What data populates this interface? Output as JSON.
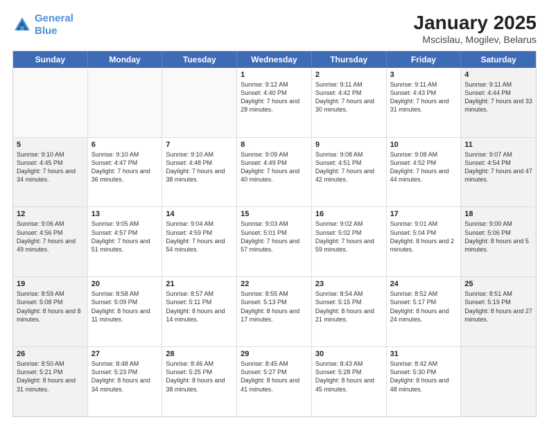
{
  "logo": {
    "line1": "General",
    "line2": "Blue"
  },
  "title": "January 2025",
  "subtitle": "Mscislau, Mogilev, Belarus",
  "days": [
    "Sunday",
    "Monday",
    "Tuesday",
    "Wednesday",
    "Thursday",
    "Friday",
    "Saturday"
  ],
  "rows": [
    [
      {
        "num": "",
        "sunrise": "",
        "sunset": "",
        "daylight": "",
        "shaded": false,
        "empty": true
      },
      {
        "num": "",
        "sunrise": "",
        "sunset": "",
        "daylight": "",
        "shaded": false,
        "empty": true
      },
      {
        "num": "",
        "sunrise": "",
        "sunset": "",
        "daylight": "",
        "shaded": false,
        "empty": true
      },
      {
        "num": "1",
        "sunrise": "Sunrise: 9:12 AM",
        "sunset": "Sunset: 4:40 PM",
        "daylight": "Daylight: 7 hours and 28 minutes.",
        "shaded": false,
        "empty": false
      },
      {
        "num": "2",
        "sunrise": "Sunrise: 9:11 AM",
        "sunset": "Sunset: 4:42 PM",
        "daylight": "Daylight: 7 hours and 30 minutes.",
        "shaded": false,
        "empty": false
      },
      {
        "num": "3",
        "sunrise": "Sunrise: 9:11 AM",
        "sunset": "Sunset: 4:43 PM",
        "daylight": "Daylight: 7 hours and 31 minutes.",
        "shaded": false,
        "empty": false
      },
      {
        "num": "4",
        "sunrise": "Sunrise: 9:11 AM",
        "sunset": "Sunset: 4:44 PM",
        "daylight": "Daylight: 7 hours and 33 minutes.",
        "shaded": true,
        "empty": false
      }
    ],
    [
      {
        "num": "5",
        "sunrise": "Sunrise: 9:10 AM",
        "sunset": "Sunset: 4:45 PM",
        "daylight": "Daylight: 7 hours and 34 minutes.",
        "shaded": true,
        "empty": false
      },
      {
        "num": "6",
        "sunrise": "Sunrise: 9:10 AM",
        "sunset": "Sunset: 4:47 PM",
        "daylight": "Daylight: 7 hours and 36 minutes.",
        "shaded": false,
        "empty": false
      },
      {
        "num": "7",
        "sunrise": "Sunrise: 9:10 AM",
        "sunset": "Sunset: 4:48 PM",
        "daylight": "Daylight: 7 hours and 38 minutes.",
        "shaded": false,
        "empty": false
      },
      {
        "num": "8",
        "sunrise": "Sunrise: 9:09 AM",
        "sunset": "Sunset: 4:49 PM",
        "daylight": "Daylight: 7 hours and 40 minutes.",
        "shaded": false,
        "empty": false
      },
      {
        "num": "9",
        "sunrise": "Sunrise: 9:08 AM",
        "sunset": "Sunset: 4:51 PM",
        "daylight": "Daylight: 7 hours and 42 minutes.",
        "shaded": false,
        "empty": false
      },
      {
        "num": "10",
        "sunrise": "Sunrise: 9:08 AM",
        "sunset": "Sunset: 4:52 PM",
        "daylight": "Daylight: 7 hours and 44 minutes.",
        "shaded": false,
        "empty": false
      },
      {
        "num": "11",
        "sunrise": "Sunrise: 9:07 AM",
        "sunset": "Sunset: 4:54 PM",
        "daylight": "Daylight: 7 hours and 47 minutes.",
        "shaded": true,
        "empty": false
      }
    ],
    [
      {
        "num": "12",
        "sunrise": "Sunrise: 9:06 AM",
        "sunset": "Sunset: 4:56 PM",
        "daylight": "Daylight: 7 hours and 49 minutes.",
        "shaded": true,
        "empty": false
      },
      {
        "num": "13",
        "sunrise": "Sunrise: 9:05 AM",
        "sunset": "Sunset: 4:57 PM",
        "daylight": "Daylight: 7 hours and 51 minutes.",
        "shaded": false,
        "empty": false
      },
      {
        "num": "14",
        "sunrise": "Sunrise: 9:04 AM",
        "sunset": "Sunset: 4:59 PM",
        "daylight": "Daylight: 7 hours and 54 minutes.",
        "shaded": false,
        "empty": false
      },
      {
        "num": "15",
        "sunrise": "Sunrise: 9:03 AM",
        "sunset": "Sunset: 5:01 PM",
        "daylight": "Daylight: 7 hours and 57 minutes.",
        "shaded": false,
        "empty": false
      },
      {
        "num": "16",
        "sunrise": "Sunrise: 9:02 AM",
        "sunset": "Sunset: 5:02 PM",
        "daylight": "Daylight: 7 hours and 59 minutes.",
        "shaded": false,
        "empty": false
      },
      {
        "num": "17",
        "sunrise": "Sunrise: 9:01 AM",
        "sunset": "Sunset: 5:04 PM",
        "daylight": "Daylight: 8 hours and 2 minutes.",
        "shaded": false,
        "empty": false
      },
      {
        "num": "18",
        "sunrise": "Sunrise: 9:00 AM",
        "sunset": "Sunset: 5:06 PM",
        "daylight": "Daylight: 8 hours and 5 minutes.",
        "shaded": true,
        "empty": false
      }
    ],
    [
      {
        "num": "19",
        "sunrise": "Sunrise: 8:59 AM",
        "sunset": "Sunset: 5:08 PM",
        "daylight": "Daylight: 8 hours and 8 minutes.",
        "shaded": true,
        "empty": false
      },
      {
        "num": "20",
        "sunrise": "Sunrise: 8:58 AM",
        "sunset": "Sunset: 5:09 PM",
        "daylight": "Daylight: 8 hours and 11 minutes.",
        "shaded": false,
        "empty": false
      },
      {
        "num": "21",
        "sunrise": "Sunrise: 8:57 AM",
        "sunset": "Sunset: 5:11 PM",
        "daylight": "Daylight: 8 hours and 14 minutes.",
        "shaded": false,
        "empty": false
      },
      {
        "num": "22",
        "sunrise": "Sunrise: 8:55 AM",
        "sunset": "Sunset: 5:13 PM",
        "daylight": "Daylight: 8 hours and 17 minutes.",
        "shaded": false,
        "empty": false
      },
      {
        "num": "23",
        "sunrise": "Sunrise: 8:54 AM",
        "sunset": "Sunset: 5:15 PM",
        "daylight": "Daylight: 8 hours and 21 minutes.",
        "shaded": false,
        "empty": false
      },
      {
        "num": "24",
        "sunrise": "Sunrise: 8:52 AM",
        "sunset": "Sunset: 5:17 PM",
        "daylight": "Daylight: 8 hours and 24 minutes.",
        "shaded": false,
        "empty": false
      },
      {
        "num": "25",
        "sunrise": "Sunrise: 8:51 AM",
        "sunset": "Sunset: 5:19 PM",
        "daylight": "Daylight: 8 hours and 27 minutes.",
        "shaded": true,
        "empty": false
      }
    ],
    [
      {
        "num": "26",
        "sunrise": "Sunrise: 8:50 AM",
        "sunset": "Sunset: 5:21 PM",
        "daylight": "Daylight: 8 hours and 31 minutes.",
        "shaded": true,
        "empty": false
      },
      {
        "num": "27",
        "sunrise": "Sunrise: 8:48 AM",
        "sunset": "Sunset: 5:23 PM",
        "daylight": "Daylight: 8 hours and 34 minutes.",
        "shaded": false,
        "empty": false
      },
      {
        "num": "28",
        "sunrise": "Sunrise: 8:46 AM",
        "sunset": "Sunset: 5:25 PM",
        "daylight": "Daylight: 8 hours and 38 minutes.",
        "shaded": false,
        "empty": false
      },
      {
        "num": "29",
        "sunrise": "Sunrise: 8:45 AM",
        "sunset": "Sunset: 5:27 PM",
        "daylight": "Daylight: 8 hours and 41 minutes.",
        "shaded": false,
        "empty": false
      },
      {
        "num": "30",
        "sunrise": "Sunrise: 8:43 AM",
        "sunset": "Sunset: 5:28 PM",
        "daylight": "Daylight: 8 hours and 45 minutes.",
        "shaded": false,
        "empty": false
      },
      {
        "num": "31",
        "sunrise": "Sunrise: 8:42 AM",
        "sunset": "Sunset: 5:30 PM",
        "daylight": "Daylight: 8 hours and 48 minutes.",
        "shaded": false,
        "empty": false
      },
      {
        "num": "",
        "sunrise": "",
        "sunset": "",
        "daylight": "",
        "shaded": true,
        "empty": true
      }
    ]
  ]
}
